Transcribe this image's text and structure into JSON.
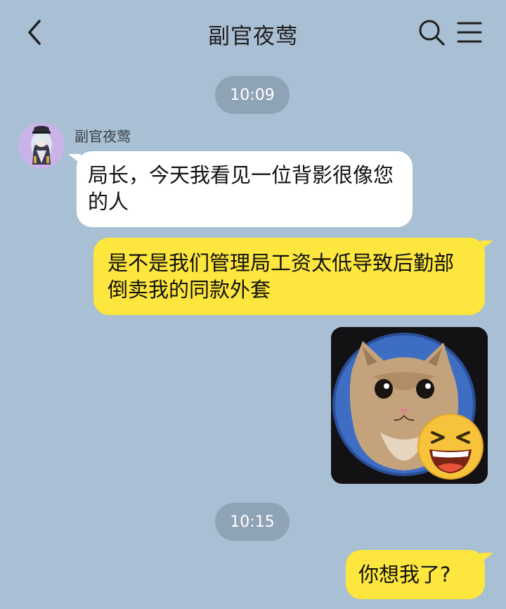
{
  "header": {
    "title": "副官夜莺",
    "back_icon": "chevron-left-icon",
    "search_icon": "search-icon",
    "menu_icon": "menu-icon"
  },
  "messages": {
    "time1": "10:09",
    "incoming": {
      "sender": "副官夜莺",
      "text": "局长，今天我看见一位背影很像您的人"
    },
    "outgoing1": {
      "text": "是不是我们管理局工资太低导致后勤部倒卖我的同款外套"
    },
    "sticker": {
      "icon": "cat-laughing-emoji-sticker"
    },
    "time2": "10:15",
    "outgoing2": {
      "text": "你想我了?"
    }
  },
  "colors": {
    "background": "#a9bfd3",
    "outgoing_bubble": "#fde63d",
    "incoming_bubble": "#ffffff",
    "time_pill": "#8fa3b7"
  }
}
